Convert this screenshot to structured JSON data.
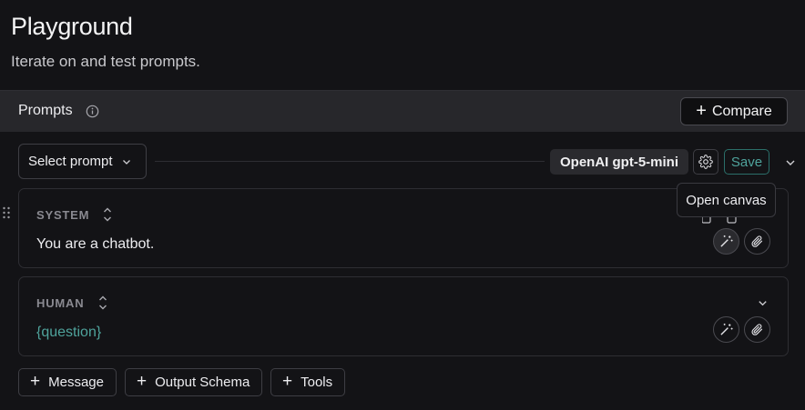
{
  "header": {
    "title": "Playground",
    "subtitle": "Iterate on and test prompts."
  },
  "prompts_bar": {
    "label": "Prompts",
    "info_icon": "info-icon",
    "compare_label": "Compare"
  },
  "toolbar": {
    "select_prompt_label": "Select prompt",
    "model_label": "OpenAI gpt-5-mini",
    "settings_icon": "gear-icon",
    "save_label": "Save"
  },
  "messages": [
    {
      "role": "SYSTEM",
      "content": "You are a chatbot."
    },
    {
      "role": "HUMAN",
      "content": "{question}"
    }
  ],
  "tooltip": {
    "text": "Open canvas"
  },
  "add_buttons": {
    "message": "Message",
    "output_schema": "Output Schema",
    "tools": "Tools"
  },
  "colors": {
    "background": "#131316",
    "bar": "#27272b",
    "accent_teal": "#4fa39c",
    "border": "#3e3e44"
  }
}
